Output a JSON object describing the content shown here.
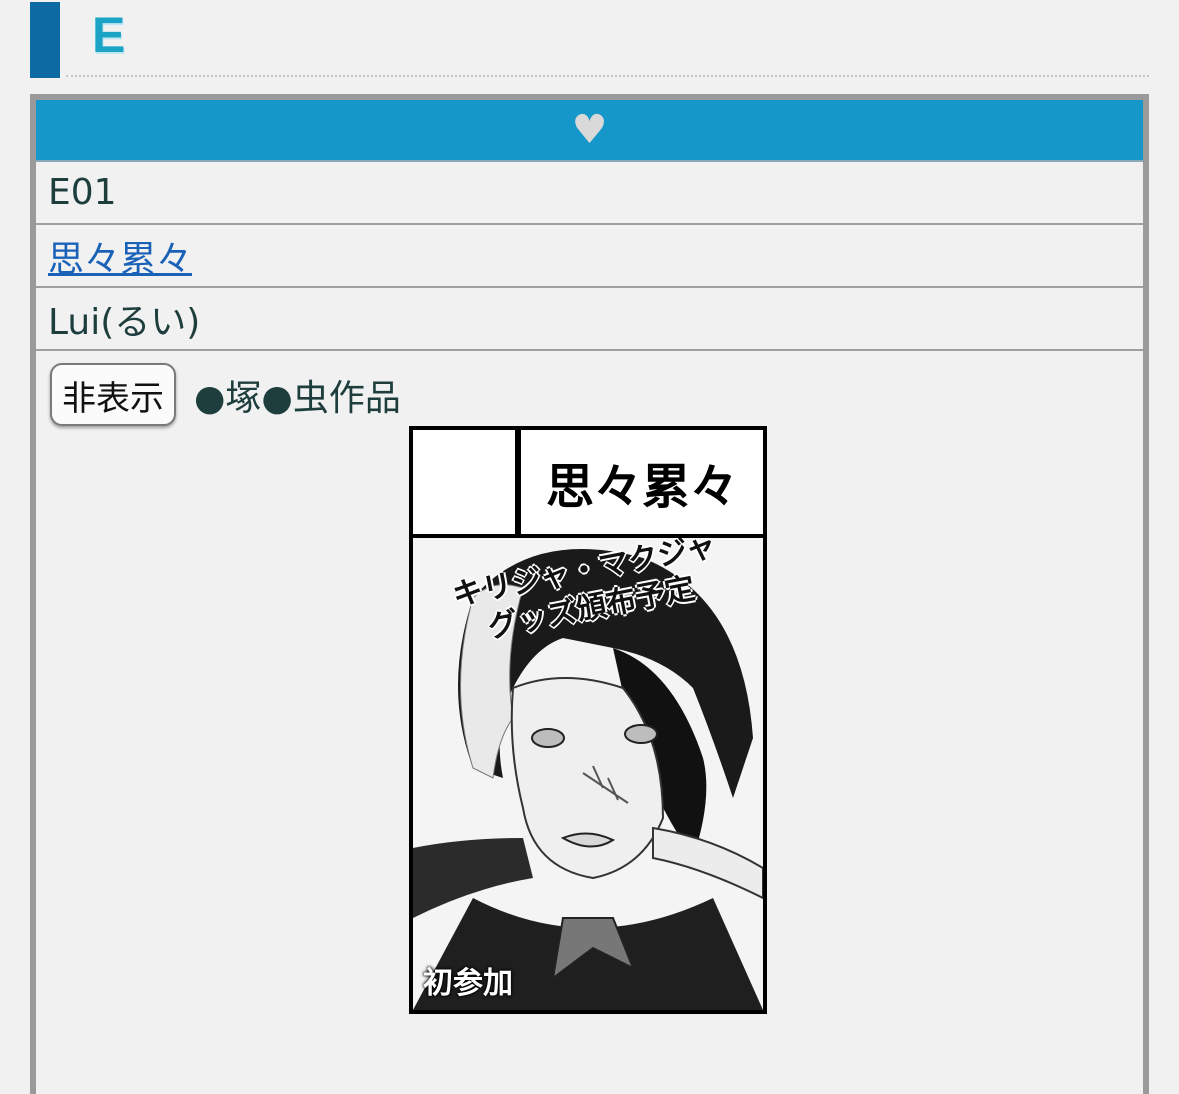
{
  "section": {
    "title": "E"
  },
  "card": {
    "header_icon": "heart-icon",
    "space_number": "E01",
    "circle_name": "思々累々",
    "author_name": "Lui(るい)",
    "hide_button_label": "非表示",
    "genre": "●塚●虫作品",
    "circle_cut": {
      "circle_name": "思々累々",
      "headline_line1": "キリジャ・マクジャ",
      "headline_line2": "グッズ頒布予定",
      "badge": "初参加"
    }
  },
  "colors": {
    "accent_bar": "#0e6aa3",
    "card_header": "#1597c9",
    "link": "#1a62b8",
    "text": "#1e3e3e"
  }
}
